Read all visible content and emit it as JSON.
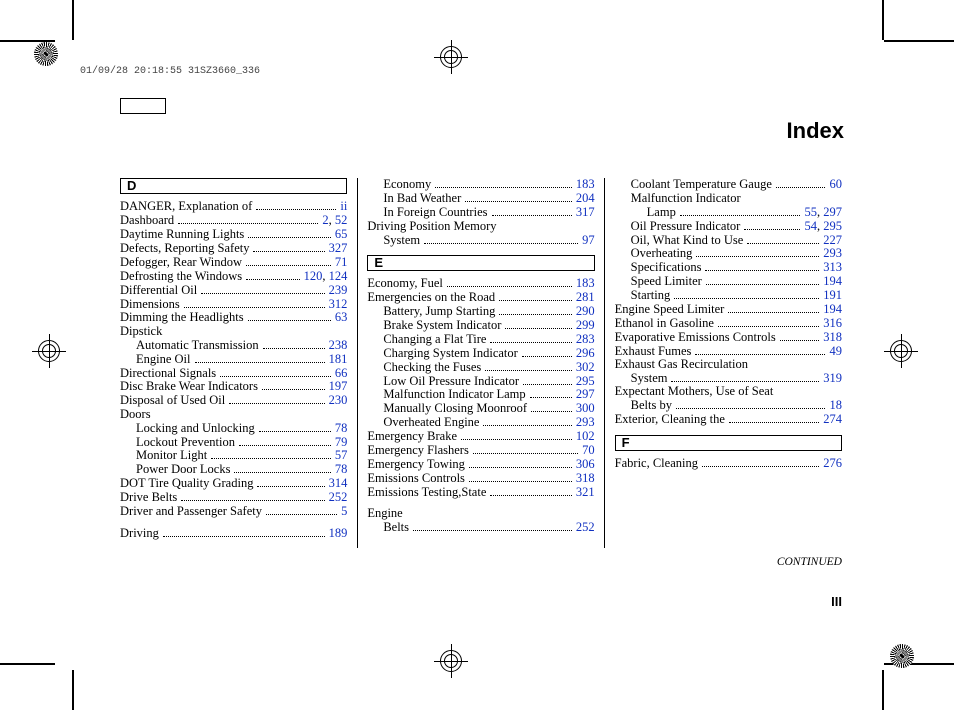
{
  "meta": {
    "timestamp": "01/09/28 20:18:55 31SZ3660_336",
    "title": "Index",
    "continued": "CONTINUED",
    "page_number": "III"
  },
  "sections": [
    {
      "letter": "D",
      "entries": [
        {
          "label": "DANGER, Explanation of",
          "pages": [
            "ii"
          ]
        },
        {
          "label": "Dashboard",
          "pages": [
            "2",
            "52"
          ]
        },
        {
          "label": "Daytime Running Lights",
          "pages": [
            "65"
          ]
        },
        {
          "label": "Defects, Reporting Safety",
          "pages": [
            "327"
          ]
        },
        {
          "label": "Defogger, Rear Window",
          "pages": [
            "71"
          ]
        },
        {
          "label": "Defrosting the Windows",
          "pages": [
            "120",
            "124"
          ]
        },
        {
          "label": "Differential Oil",
          "pages": [
            "239"
          ]
        },
        {
          "label": "Dimensions",
          "pages": [
            "312"
          ]
        },
        {
          "label": "Dimming the Headlights",
          "pages": [
            "63"
          ]
        },
        {
          "label": "Dipstick",
          "nopages": true
        },
        {
          "label": "Automatic Transmission",
          "indent": 1,
          "pages": [
            "238"
          ]
        },
        {
          "label": "Engine Oil",
          "indent": 1,
          "pages": [
            "181"
          ]
        },
        {
          "label": "Directional Signals",
          "pages": [
            "66"
          ]
        },
        {
          "label": "Disc Brake Wear Indicators",
          "pages": [
            "197"
          ]
        },
        {
          "label": "Disposal of Used Oil",
          "pages": [
            "230"
          ]
        },
        {
          "label": "Doors",
          "nopages": true
        },
        {
          "label": "Locking and Unlocking",
          "indent": 1,
          "pages": [
            "78"
          ]
        },
        {
          "label": "Lockout Prevention",
          "indent": 1,
          "pages": [
            "79"
          ]
        },
        {
          "label": "Monitor Light",
          "indent": 1,
          "pages": [
            "57"
          ]
        },
        {
          "label": "Power Door Locks",
          "indent": 1,
          "pages": [
            "78"
          ]
        },
        {
          "label": "DOT Tire Quality Grading",
          "pages": [
            "314"
          ]
        },
        {
          "label": "Drive Belts",
          "pages": [
            "252"
          ]
        },
        {
          "label": "Driver and Passenger Safety",
          "pages": [
            "5"
          ]
        }
      ]
    },
    {
      "continuation": true,
      "entries": [
        {
          "label": "Driving",
          "pages": [
            "189"
          ]
        },
        {
          "label": "Economy",
          "indent": 1,
          "pages": [
            "183"
          ]
        },
        {
          "label": "In Bad Weather",
          "indent": 1,
          "pages": [
            "204"
          ]
        },
        {
          "label": "In Foreign Countries",
          "indent": 1,
          "pages": [
            "317"
          ]
        },
        {
          "label": "Driving Position Memory",
          "nopages": true
        },
        {
          "label": "System",
          "indent": 1,
          "pages": [
            "97"
          ]
        }
      ]
    },
    {
      "letter": "E",
      "entries": [
        {
          "label": "Economy, Fuel",
          "pages": [
            "183"
          ]
        },
        {
          "label": "Emergencies on the Road",
          "pages": [
            "281"
          ]
        },
        {
          "label": "Battery, Jump Starting",
          "indent": 1,
          "pages": [
            "290"
          ]
        },
        {
          "label": "Brake System Indicator",
          "indent": 1,
          "pages": [
            "299"
          ]
        },
        {
          "label": "Changing a Flat Tire",
          "indent": 1,
          "pages": [
            "283"
          ]
        },
        {
          "label": "Charging System Indicator",
          "indent": 1,
          "pages": [
            "296"
          ]
        },
        {
          "label": "Checking the Fuses",
          "indent": 1,
          "pages": [
            "302"
          ]
        },
        {
          "label": "Low Oil Pressure Indicator",
          "indent": 1,
          "pages": [
            "295"
          ]
        },
        {
          "label": "Malfunction Indicator Lamp",
          "indent": 1,
          "pages": [
            "297"
          ]
        },
        {
          "label": "Manually Closing Moonroof",
          "indent": 1,
          "pages": [
            "300"
          ]
        },
        {
          "label": "Overheated Engine",
          "indent": 1,
          "pages": [
            "293"
          ]
        },
        {
          "label": "Emergency Brake",
          "pages": [
            "102"
          ]
        },
        {
          "label": "Emergency Flashers",
          "pages": [
            "70"
          ]
        },
        {
          "label": "Emergency Towing",
          "pages": [
            "306"
          ]
        },
        {
          "label": "Emissions Controls",
          "pages": [
            "318"
          ]
        },
        {
          "label": "Emissions Testing,State",
          "pages": [
            "321"
          ]
        }
      ]
    },
    {
      "continuation": true,
      "entries": [
        {
          "label": "Engine",
          "nopages": true
        },
        {
          "label": "Belts",
          "indent": 1,
          "pages": [
            "252"
          ]
        },
        {
          "label": "Coolant Temperature Gauge",
          "indent": 1,
          "pages": [
            "60"
          ]
        },
        {
          "label": "Malfunction Indicator",
          "indent": 1,
          "nopages": true
        },
        {
          "label": "Lamp",
          "indent": 2,
          "pages": [
            "55",
            "297"
          ]
        },
        {
          "label": "Oil Pressure Indicator",
          "indent": 1,
          "pages": [
            "54",
            "295"
          ]
        },
        {
          "label": "Oil, What Kind to Use",
          "indent": 1,
          "pages": [
            "227"
          ]
        },
        {
          "label": "Overheating",
          "indent": 1,
          "pages": [
            "293"
          ]
        },
        {
          "label": "Specifications",
          "indent": 1,
          "pages": [
            "313"
          ]
        },
        {
          "label": "Speed Limiter",
          "indent": 1,
          "pages": [
            "194"
          ]
        },
        {
          "label": "Starting",
          "indent": 1,
          "pages": [
            "191"
          ]
        },
        {
          "label": "Engine Speed Limiter",
          "pages": [
            "194"
          ]
        },
        {
          "label": "Ethanol in Gasoline",
          "pages": [
            "316"
          ]
        },
        {
          "label": "Evaporative Emissions Controls",
          "pages": [
            "318"
          ]
        },
        {
          "label": "Exhaust Fumes",
          "pages": [
            "49"
          ]
        },
        {
          "label": "Exhaust Gas Recirculation",
          "nopages": true
        },
        {
          "label": "System",
          "indent": 1,
          "pages": [
            "319"
          ]
        },
        {
          "label": "Expectant Mothers, Use of Seat",
          "nopages": true
        },
        {
          "label": "Belts by",
          "indent": 1,
          "pages": [
            "18"
          ]
        },
        {
          "label": "Exterior, Cleaning the",
          "pages": [
            "274"
          ]
        }
      ]
    },
    {
      "letter": "F",
      "entries": [
        {
          "label": "Fabric, Cleaning",
          "pages": [
            "276"
          ]
        }
      ]
    }
  ]
}
